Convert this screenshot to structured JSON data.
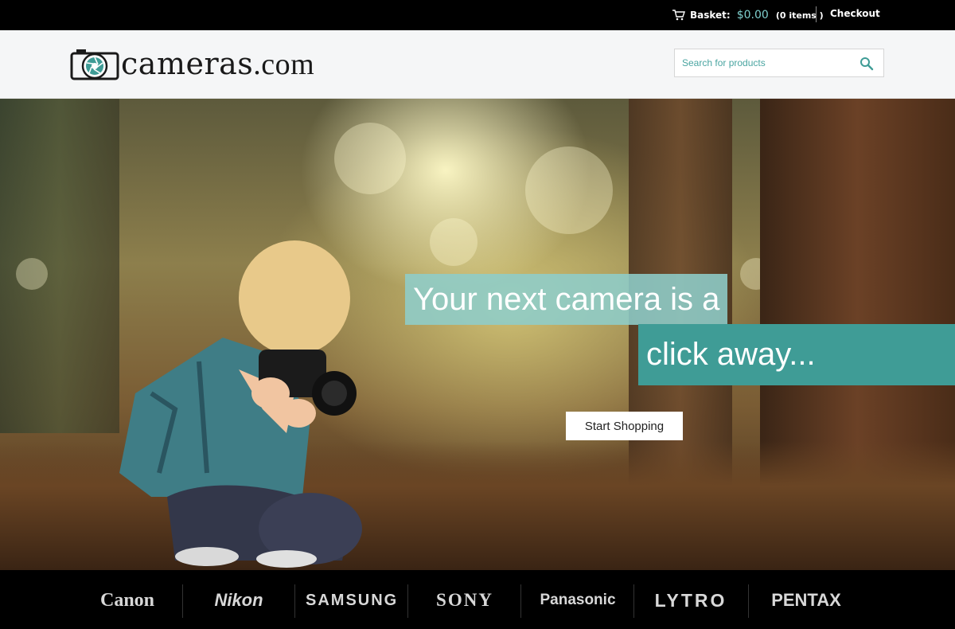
{
  "topbar": {
    "basket_label": "Basket:",
    "basket_amount": "$0.00",
    "basket_items": "(0 items )",
    "checkout_label": "Checkout"
  },
  "header": {
    "logo_name": "cameras",
    "logo_tld": ".com",
    "search_placeholder": "Search for products"
  },
  "hero": {
    "headline_line1": "Your next camera is a",
    "headline_line2": "click away...",
    "cta_label": "Start Shopping"
  },
  "brands": [
    "Canon",
    "Nikon",
    "SAMSUNG",
    "SONY",
    "Panasonic",
    "LYTRO",
    "PENTAX"
  ],
  "colors": {
    "accent": "#3f9c96",
    "accent_light": "#8ecdca",
    "basket_amount": "#7fd0cf"
  },
  "icons": {
    "cart": "shopping-cart-icon",
    "search": "magnifier-icon",
    "logo": "camera-aperture-icon"
  }
}
